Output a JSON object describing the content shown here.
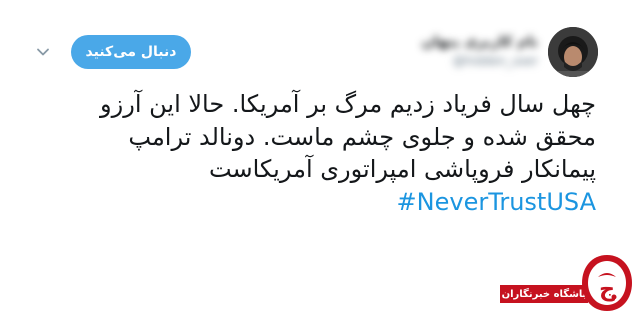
{
  "tweet": {
    "author_name": "نام کاربری پنهان",
    "author_handle": "@hidden_user",
    "follow_button_label": "دنبال می‌کنید",
    "text_lines": [
      "چهل سال فریاد زدیم مرگ بر آمریکا. حالا این آرزو",
      "محقق شده و جلوی چشم ماست. دونالد ترامپ",
      "پیمانکار فروپاشی امپراتوری آمریکاست"
    ],
    "hashtag": "#NeverTrustUSA"
  },
  "watermark": {
    "label": "باشگاه خبرنگاران",
    "logo_glyph": "ج"
  },
  "icons": {
    "menu": "chevron-down-icon"
  },
  "colors": {
    "follow_button": "#4aa8e8",
    "hashtag": "#1b95e0",
    "text": "#14171a",
    "watermark_red": "#c6121f"
  }
}
